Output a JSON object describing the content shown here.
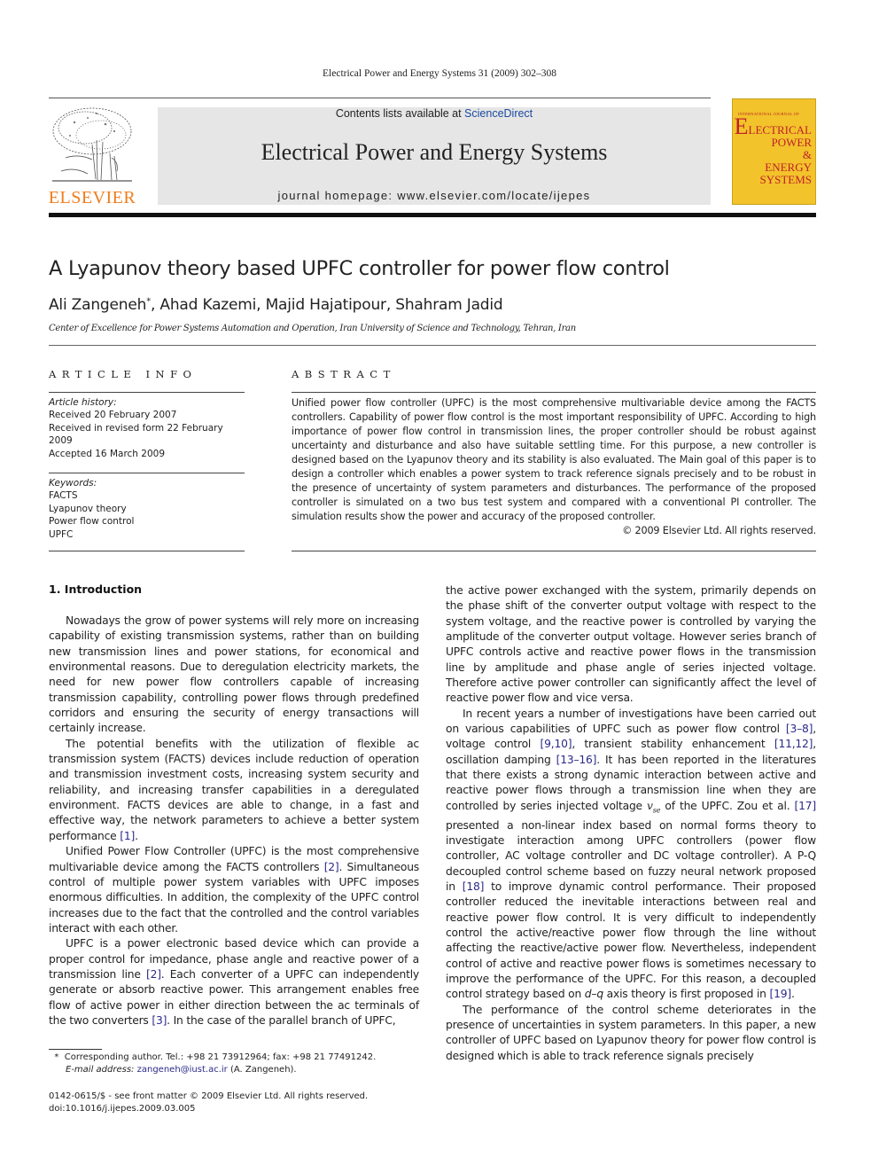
{
  "running_head": "Electrical Power and Energy Systems 31 (2009) 302–308",
  "header": {
    "publisher_logo_text": "ELSEVIER",
    "contents_prefix": "Contents lists available at ",
    "contents_link": "ScienceDirect",
    "journal_title": "Electrical Power and Energy Systems",
    "homepage": "journal homepage: www.elsevier.com/locate/ijepes",
    "cover": {
      "small_line": "INTERNATIONAL JOURNAL OF",
      "lines": [
        "LECTRICAL",
        "POWER",
        "&",
        "ENERGY",
        "SYSTEMS"
      ],
      "first_letter": "E",
      "background": "#f2c32b",
      "text_color": "#c0202a"
    },
    "logo_color": "#f07c1b"
  },
  "article": {
    "title": "A Lyapunov theory based UPFC controller for power flow control",
    "authors": [
      {
        "name": "Ali Zangeneh",
        "mark": "*"
      },
      {
        "name": "Ahad Kazemi",
        "mark": ""
      },
      {
        "name": "Majid Hajatipour",
        "mark": ""
      },
      {
        "name": "Shahram Jadid",
        "mark": ""
      }
    ],
    "affiliation": "Center of Excellence for Power Systems Automation and Operation, Iran University of Science and Technology, Tehran, Iran"
  },
  "article_info": {
    "heading": "ARTICLE INFO",
    "history_label": "Article history:",
    "history": [
      "Received 20 February 2007",
      "Received in revised form 22 February 2009",
      "Accepted 16 March 2009"
    ],
    "keywords_label": "Keywords:",
    "keywords": [
      "FACTS",
      "Lyapunov theory",
      "Power flow control",
      "UPFC"
    ]
  },
  "abstract": {
    "heading": "ABSTRACT",
    "text": "Unified power flow controller (UPFC) is the most comprehensive multivariable device among the FACTS controllers. Capability of power flow control is the most important responsibility of UPFC. According to high importance of power flow control in transmission lines, the proper controller should be robust against uncertainty and disturbance and also have suitable settling time. For this purpose, a new controller is designed based on the Lyapunov theory and its stability is also evaluated. The Main goal of this paper is to design a controller which enables a power system to track reference signals precisely and to be robust in the presence of uncertainty of system parameters and disturbances. The performance of the proposed controller is simulated on a two bus test system and compared with a conventional PI controller. The simulation results show the power and accuracy of the proposed controller.",
    "copyright": "© 2009 Elsevier Ltd. All rights reserved."
  },
  "intro": {
    "heading": "1. Introduction",
    "left": {
      "p1": "Nowadays the grow of power systems will rely more on increasing capability of existing transmission systems, rather than on building new transmission lines and power stations, for economical and environmental reasons. Due to deregulation electricity markets, the need for new power flow controllers capable of increasing transmission capability, controlling power flows through predefined corridors and ensuring the security of energy transactions will certainly increase.",
      "p2a": "The potential benefits with the utilization of flexible ac transmission system (FACTS) devices include reduction of operation and transmission investment costs, increasing system security and reliability, and increasing transfer capabilities in a deregulated environment. FACTS devices are able to change, in a fast and effective way, the network parameters to achieve a better system performance ",
      "p2_ref": "[1]",
      "p2b": ".",
      "p3a": "Unified Power Flow Controller (UPFC) is the most comprehensive multivariable device among the FACTS controllers ",
      "p3_ref": "[2]",
      "p3b": ". Simultaneous control of multiple power system variables with UPFC imposes enormous difficulties. In addition, the complexity of the UPFC control increases due to the fact that the controlled and the control variables interact with each other.",
      "p4a": "UPFC is a power electronic based device which can provide a proper control for impedance, phase angle and reactive power of a transmission line ",
      "p4_ref1": "[2]",
      "p4b": ". Each converter of a UPFC can independently generate or absorb reactive power. This arrangement enables free flow of active power in either direction between the ac terminals of the two converters ",
      "p4_ref2": "[3]",
      "p4c": ". In the case of the parallel branch of UPFC,"
    },
    "right": {
      "p1": "the active power exchanged with the system, primarily depends on the phase shift of the converter output voltage with respect to the system voltage, and the reactive power is controlled by varying the amplitude of the converter output voltage. However series branch of UPFC controls active and reactive power flows in the transmission line by amplitude and phase angle of series injected voltage. Therefore active power controller can significantly affect the level of reactive power flow and vice versa.",
      "p2a": "In recent years a number of investigations have been carried out on various capabilities of UPFC such as power flow control ",
      "ref_3_8": "[3–8]",
      "p2b": ", voltage control ",
      "ref_9_10": "[9,10]",
      "p2c": ", transient stability enhancement ",
      "ref_11_12": "[11,12]",
      "p2d": ", oscillation damping ",
      "ref_13_16": "[13–16]",
      "p2e": ". It has been reported in the literatures that there exists a strong dynamic interaction between active and reactive power flows through a transmission line when they are controlled by series injected voltage ",
      "vse_base": "v",
      "vse_sub": "se",
      "p2f": " of the UPFC. Zou et al. ",
      "ref_17": "[17]",
      "p2g": " presented a non-linear index based on normal forms theory to investigate interaction among UPFC controllers (power flow controller, AC voltage controller and DC voltage controller). A P-Q decoupled control scheme based on fuzzy neural network proposed in ",
      "ref_18": "[18]",
      "p2h": " to improve dynamic control performance. Their proposed controller reduced the inevitable interactions between real and reactive power flow control. It is very difficult to independently control the active/reactive power flow through the line without affecting the reactive/active power flow. Nevertheless, independent control of active and reactive power flows is sometimes necessary to improve the performance of the UPFC. For this reason, a decoupled control strategy based on ",
      "dq": "d–q",
      "p2i": " axis theory is first proposed in ",
      "ref_19": "[19]",
      "p2j": ".",
      "p3": "The performance of the control scheme deteriorates in the presence of uncertainties in system parameters. In this paper, a new controller of UPFC based on Lyapunov theory for power flow control is designed which is able to track reference signals precisely"
    }
  },
  "footnote": {
    "mark": "*",
    "line1": "Corresponding author. Tel.: +98 21 73912964; fax: +98 21 77491242.",
    "email_label": "E-mail address:",
    "email": "zangeneh@iust.ac.ir",
    "email_suffix": " (A. Zangeneh)."
  },
  "issn_line": "0142-0615/$ - see front matter © 2009 Elsevier Ltd. All rights reserved.",
  "doi_line": "doi:10.1016/j.ijepes.2009.03.005"
}
